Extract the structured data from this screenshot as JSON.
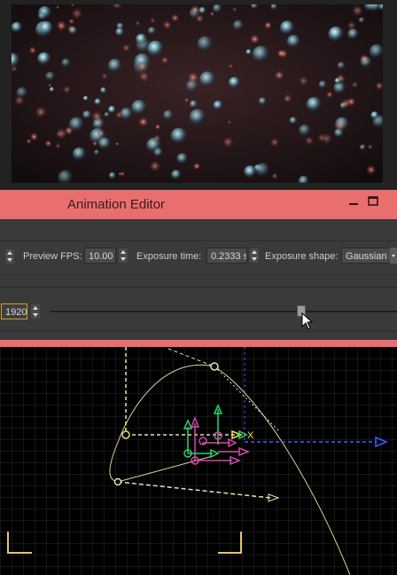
{
  "window": {
    "title": "Animation Editor"
  },
  "toolbar": {
    "preview_fps_label": "Preview FPS:",
    "preview_fps_value": "10.00",
    "exposure_time_label": "Exposure time:",
    "exposure_time_value": "0.2333 s",
    "exposure_shape_label": "Exposure shape:",
    "exposure_shape_value": "Gaussian",
    "frame_value": "1920"
  },
  "timeline": {
    "position_fraction": 0.72
  },
  "viewport": {
    "gizmo_axis_label": "X"
  },
  "colors": {
    "titlebar": "#e96f6f",
    "curve": "#d8cf9a",
    "axis_green": "#2fd36a",
    "axis_magenta": "#d14aa8",
    "axis_blue": "#3a5fff",
    "gizmo_yellow": "#f2e24a"
  }
}
